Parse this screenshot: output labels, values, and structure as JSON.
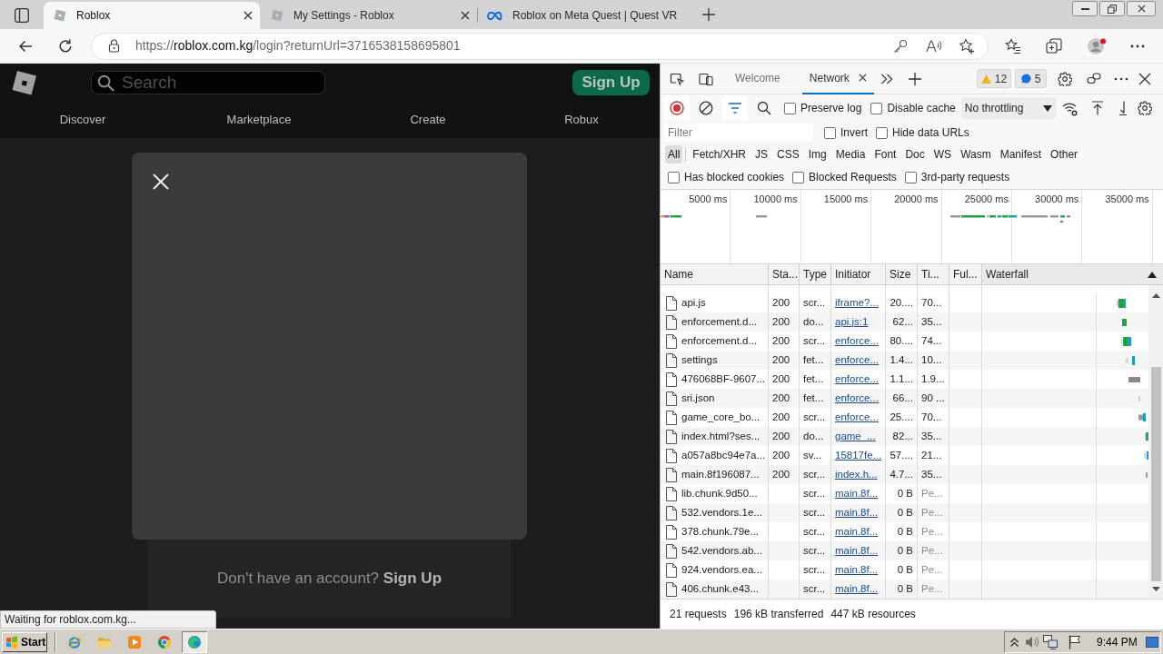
{
  "browser": {
    "tabs": [
      {
        "kind": "roblox",
        "title": "Roblox",
        "selected": true,
        "closable": true
      },
      {
        "kind": "roblox",
        "title": "My Settings - Roblox",
        "selected": false,
        "closable": true
      },
      {
        "kind": "meta",
        "title": "Roblox on Meta Quest | Quest VR",
        "selected": false,
        "closable": false
      }
    ],
    "url": {
      "scheme": "https://",
      "host": "roblox.com.kg",
      "path": "/login?returnUrl=3716538158695801"
    }
  },
  "page": {
    "search": {
      "placeholder": "Search"
    },
    "sign_up": "Sign Up",
    "nav": [
      "Discover",
      "Marketplace",
      "Create",
      "Robux"
    ],
    "footer": {
      "text": "Don't have an account?",
      "link": "Sign Up"
    },
    "loading_status": "Waiting for roblox.com.kg..."
  },
  "devtools": {
    "tabs": [
      {
        "label": "Welcome",
        "selected": false,
        "closable": false
      },
      {
        "label": "Network",
        "selected": true,
        "closable": true
      }
    ],
    "warnings": "12",
    "messages": "5",
    "recording": true,
    "toolbar_checks": [
      {
        "label": "Preserve log",
        "checked": false
      },
      {
        "label": "Disable cache",
        "checked": false
      }
    ],
    "throttling": "No throttling",
    "filter": {
      "placeholder": "Filter"
    },
    "filter_checks": [
      {
        "label": "Invert",
        "checked": false
      },
      {
        "label": "Hide data URLs",
        "checked": false
      }
    ],
    "types": [
      {
        "label": "All",
        "selected": true
      },
      {
        "label": "Fetch/XHR",
        "selected": false
      },
      {
        "label": "JS",
        "selected": false
      },
      {
        "label": "CSS",
        "selected": false
      },
      {
        "label": "Img",
        "selected": false
      },
      {
        "label": "Media",
        "selected": false
      },
      {
        "label": "Font",
        "selected": false
      },
      {
        "label": "Doc",
        "selected": false
      },
      {
        "label": "WS",
        "selected": false
      },
      {
        "label": "Wasm",
        "selected": false
      },
      {
        "label": "Manifest",
        "selected": false
      },
      {
        "label": "Other",
        "selected": false
      }
    ],
    "request_checks": [
      {
        "label": "Has blocked cookies",
        "checked": false
      },
      {
        "label": "Blocked Requests",
        "checked": false
      },
      {
        "label": "3rd-party requests",
        "checked": false
      }
    ],
    "overview_ticks": [
      "5000 ms",
      "10000 ms",
      "15000 ms",
      "20000 ms",
      "25000 ms",
      "30000 ms",
      "35000 ms"
    ],
    "table": {
      "columns": [
        "Name",
        "Sta...",
        "Type",
        "Initiator",
        "Size",
        "Ti...",
        "Ful...",
        "Waterfall"
      ],
      "rows": [
        {
          "name": "api.js",
          "status": "200",
          "type": "scr...",
          "initiator": "iframe?...",
          "size": "20....",
          "time": "70...",
          "pending": false
        },
        {
          "name": "enforcement.d...",
          "status": "200",
          "type": "do...",
          "initiator": "api.js:1",
          "size": "62...",
          "time": "35...",
          "pending": false
        },
        {
          "name": "enforcement.d...",
          "status": "200",
          "type": "scr...",
          "initiator": "enforce...",
          "size": "80....",
          "time": "74...",
          "pending": false
        },
        {
          "name": "settings",
          "status": "200",
          "type": "fet...",
          "initiator": "enforce...",
          "size": "1.4...",
          "time": "10...",
          "pending": false
        },
        {
          "name": "476068BF-9607...",
          "status": "200",
          "type": "fet...",
          "initiator": "enforce...",
          "size": "1.1...",
          "time": "1.9...",
          "pending": false
        },
        {
          "name": "sri.json",
          "status": "200",
          "type": "fet...",
          "initiator": "enforce...",
          "size": "66...",
          "time": "90 ...",
          "pending": false
        },
        {
          "name": "game_core_bo...",
          "status": "200",
          "type": "scr...",
          "initiator": "enforce...",
          "size": "25....",
          "time": "70...",
          "pending": false
        },
        {
          "name": "index.html?ses...",
          "status": "200",
          "type": "do...",
          "initiator": "game_...",
          "size": "82...",
          "time": "35...",
          "pending": false
        },
        {
          "name": "a057a8bc94e7a...",
          "status": "200",
          "type": "sv...",
          "initiator": "15817fe...",
          "size": "57....",
          "time": "21...",
          "pending": false
        },
        {
          "name": "main.8f196087...",
          "status": "200",
          "type": "scr...",
          "initiator": "index.h...",
          "size": "4.7...",
          "time": "35...",
          "pending": false
        },
        {
          "name": "lib.chunk.9d50...",
          "type": "scr...",
          "initiator": "main.8f...",
          "size": "0 B",
          "time": "Pe...",
          "pending": true
        },
        {
          "name": "532.vendors.1e...",
          "type": "scr...",
          "initiator": "main.8f...",
          "size": "0 B",
          "time": "Pe...",
          "pending": true
        },
        {
          "name": "378.chunk.79e...",
          "type": "scr...",
          "initiator": "main.8f...",
          "size": "0 B",
          "time": "Pe...",
          "pending": true
        },
        {
          "name": "542.vendors.ab...",
          "type": "scr...",
          "initiator": "main.8f...",
          "size": "0 B",
          "time": "Pe...",
          "pending": true
        },
        {
          "name": "924.vendors.ea...",
          "type": "scr...",
          "initiator": "main.8f...",
          "size": "0 B",
          "time": "Pe...",
          "pending": true
        },
        {
          "name": "406.chunk.e43...",
          "type": "scr...",
          "initiator": "main.8f...",
          "size": "0 B",
          "time": "Pe...",
          "pending": true
        }
      ]
    },
    "summary": [
      "21 requests",
      "196 kB transferred",
      "447 kB resources"
    ]
  },
  "taskbar": {
    "start": "Start",
    "clock": "9:44 PM"
  }
}
